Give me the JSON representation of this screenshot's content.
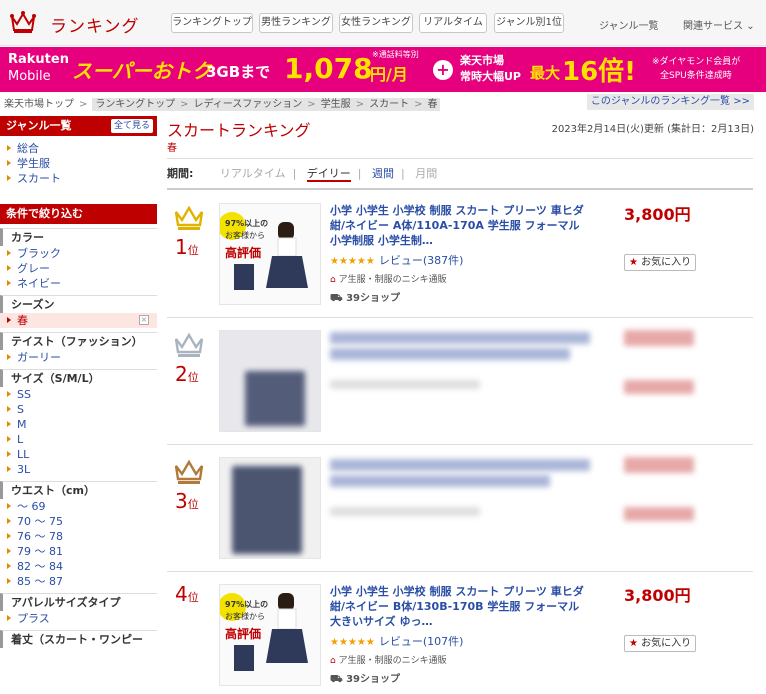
{
  "header": {
    "logo_text": "ランキング",
    "nav": [
      "ランキングトップ",
      "男性ランキング",
      "女性ランキング",
      "リアルタイム",
      "ジャンル別1位"
    ],
    "links": [
      "ジャンル一覧",
      "関連サービス"
    ]
  },
  "banner": {
    "brand_line1": "Rakuten",
    "brand_line2": "Mobile",
    "promo": "スーパーおトク",
    "plan_size": "3GBまで",
    "plan_price": "1,078",
    "plan_unit": "円/月",
    "plan_note": "※通話料等別",
    "plus": "+",
    "market_line1": "楽天市場",
    "market_line2": "常時大幅UP",
    "max_label": "最大",
    "multiplier": "16倍!",
    "fine1": "※ダイヤモンド会員が",
    "fine2": "全SPU条件達成時"
  },
  "breadcrumb": {
    "items": [
      "楽天市場トップ",
      "ランキングトップ",
      "レディースファッション",
      "学生服",
      "スカート",
      "春"
    ],
    "genre_list_link": "このジャンルのランキング一覧 >>"
  },
  "sidebar": {
    "genre_head": "ジャンル一覧",
    "all_view": "全て見る",
    "genres": [
      "総合",
      "学生服",
      "スカート"
    ],
    "filter_head": "条件で絞り込む",
    "sections": [
      {
        "title": "カラー",
        "items": [
          "ブラック",
          "グレー",
          "ネイビー"
        ]
      },
      {
        "title": "シーズン",
        "items": [
          "春"
        ],
        "active": 0
      },
      {
        "title": "テイスト（ファッション）",
        "items": [
          "ガーリー"
        ]
      },
      {
        "title": "サイズ（S/M/L）",
        "items": [
          "SS",
          "S",
          "M",
          "L",
          "LL",
          "3L"
        ]
      },
      {
        "title": "ウエスト（cm）",
        "items": [
          "～ 69",
          "70 ～ 75",
          "76 ～ 78",
          "79 ～ 81",
          "82 ～ 84",
          "85 ～ 87"
        ]
      },
      {
        "title": "アパレルサイズタイプ",
        "items": [
          "プラス"
        ]
      },
      {
        "title": "着丈（スカート・ワンピー",
        "items": []
      }
    ]
  },
  "main": {
    "title": "スカートランキング",
    "subtitle": "春",
    "updated": "2023年2月14日(火)更新 (集計日：2月13日)",
    "period_label": "期間:",
    "periods": [
      "リアルタイム",
      "デイリー",
      "週間",
      "月間"
    ],
    "items": [
      {
        "rank": "1",
        "rank_suffix": "位",
        "title": "小学 小学生 小学校 制服 スカート プリーツ 車ヒダ 紺/ネイビー A体/110A-170A 学生服 フォーマル 小学制服 小学生制…",
        "stars": "★★★★★",
        "review": "レビュー(387件)",
        "shop": "ア生服・制服のニシキ通販",
        "points": "39ショップ",
        "price": "3,800円",
        "fav": "お気に入り",
        "thumb_text1": "97%以上の",
        "thumb_text2": "お客様から",
        "thumb_text3": "高評価"
      },
      {
        "rank": "2",
        "rank_suffix": "位"
      },
      {
        "rank": "3",
        "rank_suffix": "位"
      },
      {
        "rank": "4",
        "rank_suffix": "位",
        "title": "小学 小学生 小学校 制服 スカート プリーツ 車ヒダ 紺/ネイビー B体/130B-170B 学生服 フォーマル 大きいサイズ ゆっ…",
        "stars": "★★★★★",
        "review": "レビュー(107件)",
        "shop": "ア生服・制服のニシキ通販",
        "points": "39ショップ",
        "price": "3,800円",
        "fav": "お気に入り",
        "thumb_text1": "97%以上の",
        "thumb_text2": "お客様から",
        "thumb_text3": "高評価"
      }
    ]
  },
  "colors": {
    "accent": "#bf0000",
    "link": "#2a4ea5",
    "banner": "#e6007e",
    "gold": "#e0b300",
    "silver": "#aab4c0",
    "bronze": "#b07a3a"
  }
}
